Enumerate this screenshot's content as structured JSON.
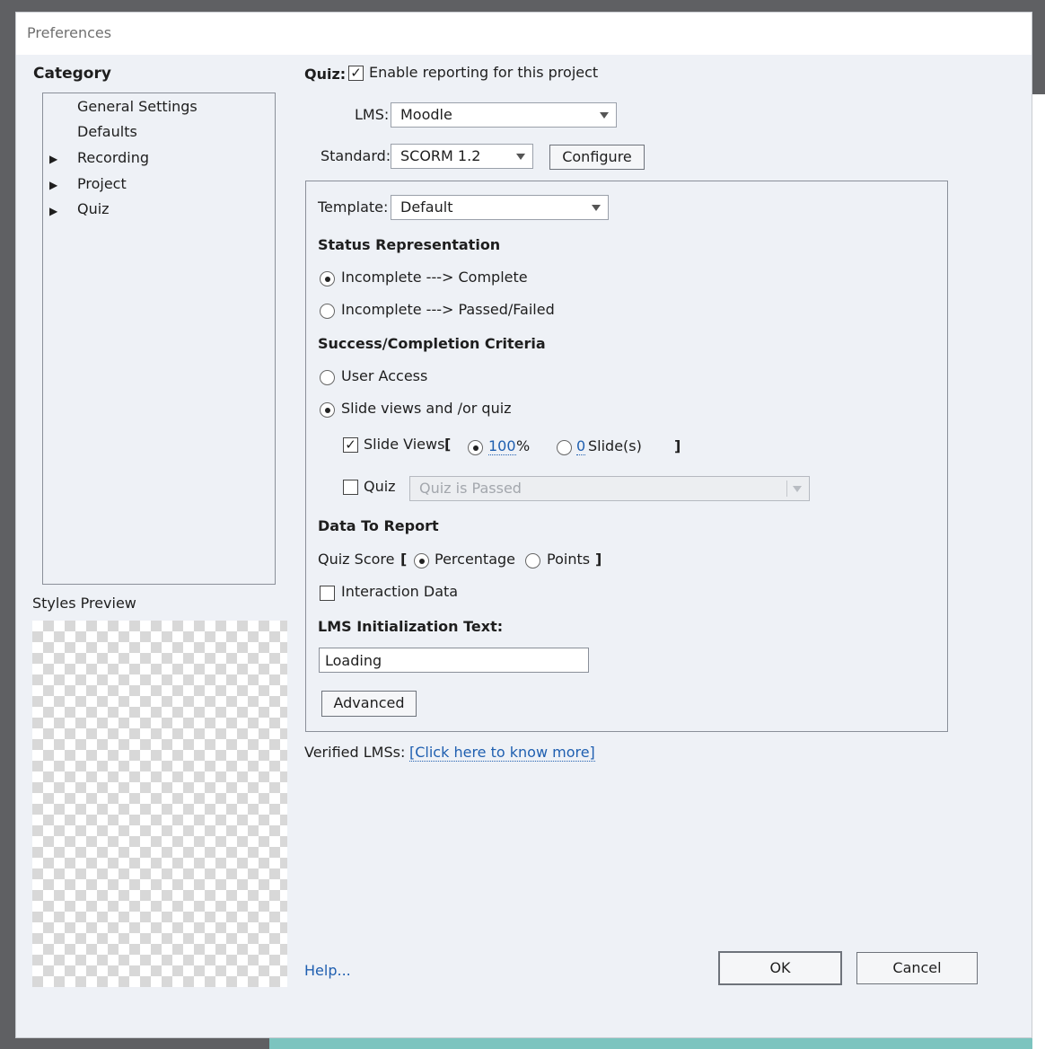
{
  "window": {
    "title": "Preferences"
  },
  "sidebar": {
    "heading": "Category",
    "items": [
      {
        "label": "General Settings",
        "expandable": false
      },
      {
        "label": "Defaults",
        "expandable": false
      },
      {
        "label": "Recording",
        "expandable": true
      },
      {
        "label": "Project",
        "expandable": true
      },
      {
        "label": "Quiz",
        "expandable": true
      }
    ],
    "styles_preview_label": "Styles Preview"
  },
  "quiz": {
    "label": "Quiz:",
    "enable_reporting_label": "Enable reporting for this project",
    "enable_reporting_checked": true,
    "lms_label": "LMS:",
    "lms_value": "Moodle",
    "standard_label": "Standard:",
    "standard_value": "SCORM 1.2",
    "configure_button": "Configure"
  },
  "panel": {
    "template_label": "Template:",
    "template_value": "Default",
    "status_heading": "Status Representation",
    "status_options": [
      {
        "label": "Incomplete ---> Complete",
        "selected": true
      },
      {
        "label": "Incomplete ---> Passed/Failed",
        "selected": false
      }
    ],
    "criteria_heading": "Success/Completion Criteria",
    "criteria_options": [
      {
        "label": "User Access",
        "selected": false
      },
      {
        "label": "Slide views and /or quiz",
        "selected": true
      }
    ],
    "slide_views": {
      "label": "Slide Views",
      "checked": true,
      "open_bracket": "[",
      "percent_value": "100",
      "percent_symbol": "%",
      "percent_selected": true,
      "slides_value": "0",
      "slides_label": "Slide(s)",
      "slides_selected": false,
      "close_bracket": "]"
    },
    "quiz_criteria": {
      "label": "Quiz",
      "checked": false,
      "value": "Quiz is Passed"
    },
    "data_heading": "Data To Report",
    "quiz_score": {
      "label": "Quiz Score",
      "open_bracket": "[",
      "percentage_label": "Percentage",
      "percentage_selected": true,
      "points_label": "Points",
      "points_selected": false,
      "close_bracket": "]"
    },
    "interaction_data": {
      "label": "Interaction Data",
      "checked": false
    },
    "init_text_heading": "LMS Initialization Text:",
    "init_text_value": "Loading",
    "advanced_button": "Advanced"
  },
  "verified": {
    "label": "Verified LMSs:",
    "link": "[Click here to know more]"
  },
  "footer": {
    "help_link": "Help...",
    "ok_button": "OK",
    "cancel_button": "Cancel"
  },
  "colors": {
    "dialog_bg": "#eef1f6",
    "link": "#1f5fb0",
    "backdrop": "#5f6063",
    "teal": "#7cc4bf"
  }
}
